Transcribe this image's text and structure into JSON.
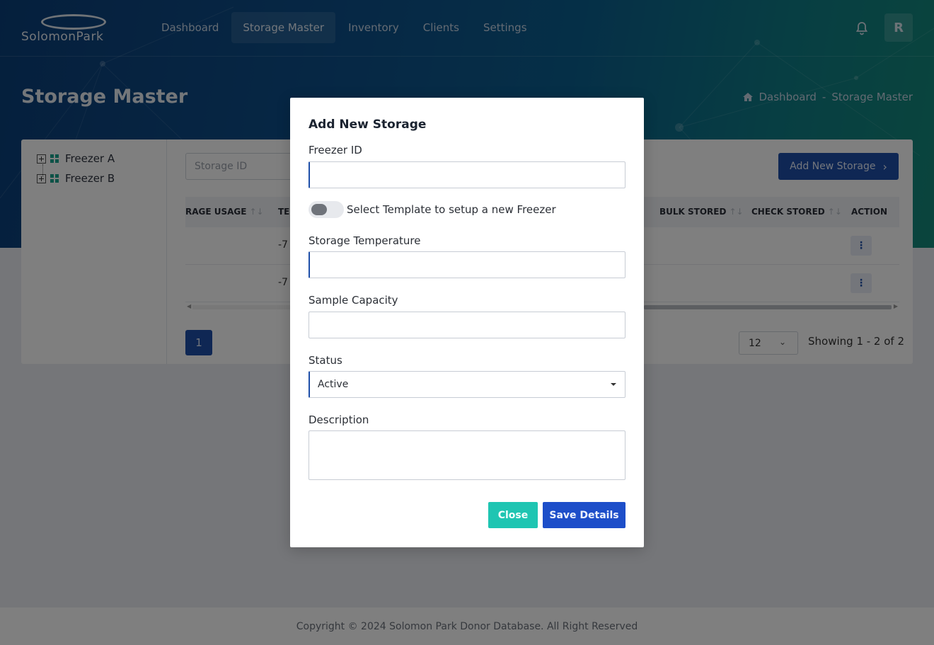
{
  "brand": {
    "logo_text": "SolomonPark"
  },
  "nav": {
    "items": [
      {
        "label": "Dashboard"
      },
      {
        "label": "Storage Master"
      },
      {
        "label": "Inventory"
      },
      {
        "label": "Clients"
      },
      {
        "label": "Settings"
      }
    ],
    "active": "Storage Master",
    "avatar_initial": "R"
  },
  "page": {
    "title": "Storage Master",
    "breadcrumb": {
      "home": "Dashboard",
      "separator": "-",
      "current": "Storage Master"
    }
  },
  "tree": {
    "items": [
      {
        "label": "Freezer A"
      },
      {
        "label": "Freezer B"
      }
    ]
  },
  "toolbar": {
    "search_placeholder": "Storage ID",
    "add_button_label": "Add New Storage"
  },
  "table": {
    "columns": {
      "storage_usage": "RAGE USAGE",
      "temperature": "TE",
      "bulk_stored": "BULK STORED",
      "check_stored": "CHECK STORED",
      "action": "ACTION"
    },
    "rows": [
      {
        "temperature": "-7"
      },
      {
        "temperature": "-7"
      }
    ]
  },
  "pagination": {
    "current_page": "1",
    "per_page": "12",
    "showing_text": "Showing 1 - 2 of 2"
  },
  "footer": {
    "copyright": "Copyright © 2024 Solomon Park Donor Database. All Right Reserved"
  },
  "modal": {
    "title": "Add New Storage",
    "fields": {
      "freezer_id_label": "Freezer ID",
      "freezer_id_value": "",
      "template_toggle_label": "Select Template to setup a new Freezer",
      "template_toggle_on": false,
      "temperature_label": "Storage Temperature",
      "temperature_value": "",
      "capacity_label": "Sample Capacity",
      "capacity_value": "",
      "status_label": "Status",
      "status_value": "Active",
      "description_label": "Description",
      "description_value": ""
    },
    "close_label": "Close",
    "save_label": "Save Details"
  },
  "colors": {
    "primary": "#1e4fa8",
    "accent_teal": "#1fc5b2",
    "save_blue": "#1d4ec9",
    "tree_icon": "#1aa58f"
  },
  "icons": {
    "bell": "bell-icon",
    "home": "home-icon",
    "chevron_right": "chevron-right-icon",
    "sort": "sort-icon",
    "kebab": "kebab-menu-icon",
    "chevron_down": "chevron-down-icon"
  }
}
